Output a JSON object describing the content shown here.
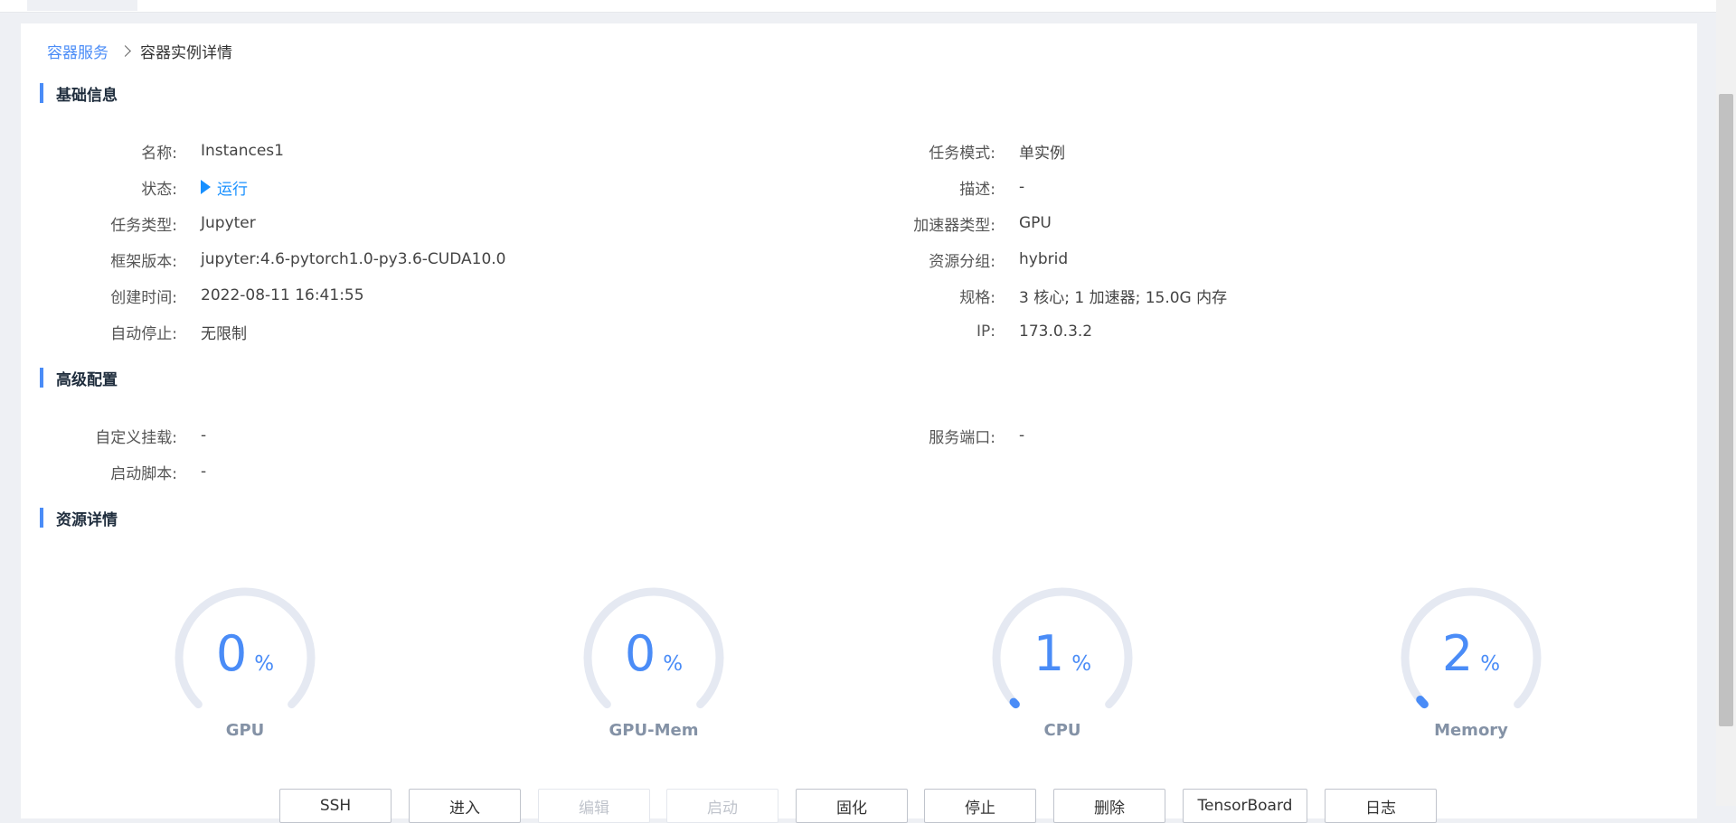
{
  "breadcrumb": {
    "parent": "容器服务",
    "current": "容器实例详情"
  },
  "sections": {
    "basic": "基础信息",
    "advanced": "高级配置",
    "resources": "资源详情"
  },
  "basic_left": [
    {
      "label": "名称:",
      "value": "Instances1"
    },
    {
      "label": "状态:",
      "value": "运行"
    },
    {
      "label": "任务类型:",
      "value": "Jupyter"
    },
    {
      "label": "框架版本:",
      "value": "jupyter:4.6-pytorch1.0-py3.6-CUDA10.0"
    },
    {
      "label": "创建时间:",
      "value": "2022-08-11 16:41:55"
    },
    {
      "label": "自动停止:",
      "value": "无限制"
    }
  ],
  "basic_right": [
    {
      "label": "任务模式:",
      "value": "单实例"
    },
    {
      "label": "描述:",
      "value": "-"
    },
    {
      "label": "加速器类型:",
      "value": "GPU"
    },
    {
      "label": "资源分组:",
      "value": "hybrid"
    },
    {
      "label": "规格:",
      "value": "3 核心; 1 加速器; 15.0G 内存"
    },
    {
      "label": "IP:",
      "value": "173.0.3.2"
    }
  ],
  "advanced_left": [
    {
      "label": "自定义挂载:",
      "value": "-"
    },
    {
      "label": "启动脚本:",
      "value": "-"
    }
  ],
  "advanced_right": [
    {
      "label": "服务端口:",
      "value": "-"
    }
  ],
  "gauges": [
    {
      "label": "GPU",
      "value": "0",
      "percent": 0
    },
    {
      "label": "GPU-Mem",
      "value": "0",
      "percent": 0
    },
    {
      "label": "CPU",
      "value": "1",
      "percent": 1
    },
    {
      "label": "Memory",
      "value": "2",
      "percent": 2
    }
  ],
  "gauge_unit": "%",
  "colors": {
    "accent": "#4a8cf7",
    "status": "#1890ff",
    "gauge_track": "#e5e9f2",
    "gauge_label": "#8492a6"
  },
  "buttons": [
    {
      "label": "SSH",
      "disabled": false
    },
    {
      "label": "进入",
      "disabled": false
    },
    {
      "label": "编辑",
      "disabled": true
    },
    {
      "label": "启动",
      "disabled": true
    },
    {
      "label": "固化",
      "disabled": false
    },
    {
      "label": "停止",
      "disabled": false
    },
    {
      "label": "删除",
      "disabled": false
    },
    {
      "label": "TensorBoard",
      "disabled": false
    },
    {
      "label": "日志",
      "disabled": false
    }
  ]
}
